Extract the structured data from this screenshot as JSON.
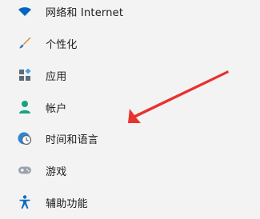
{
  "nav": {
    "items": [
      {
        "label": "网络和 Internet",
        "icon": "wifi-icon"
      },
      {
        "label": "个性化",
        "icon": "brush-icon"
      },
      {
        "label": "应用",
        "icon": "apps-icon"
      },
      {
        "label": "帐户",
        "icon": "account-icon"
      },
      {
        "label": "时间和语言",
        "icon": "time-language-icon"
      },
      {
        "label": "游戏",
        "icon": "gamepad-icon"
      },
      {
        "label": "辅助功能",
        "icon": "accessibility-icon"
      }
    ]
  },
  "annotation": {
    "arrow_color": "#e8322f"
  }
}
